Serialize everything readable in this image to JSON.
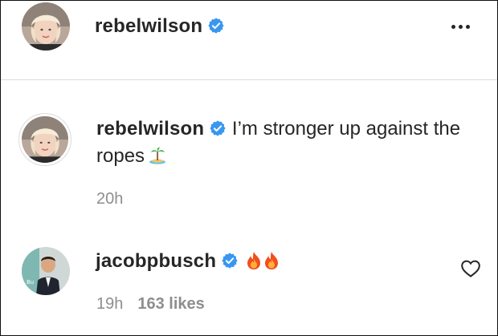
{
  "header": {
    "username": "rebelwilson",
    "verified": true
  },
  "post": {
    "caption": {
      "username": "rebelwilson",
      "verified": true,
      "text": "I’m stronger up against the ropes",
      "emoji": "desert-island-emoji",
      "time": "20h"
    }
  },
  "comments": [
    {
      "username": "jacobpbusch",
      "verified": true,
      "emojis": [
        "fire-emoji",
        "fire-emoji"
      ],
      "time": "19h",
      "likes": "163 likes"
    }
  ],
  "colors": {
    "text": "#262626",
    "muted": "#8e8e8e",
    "verified": "#3897f0",
    "divider": "#dbdbdb"
  }
}
